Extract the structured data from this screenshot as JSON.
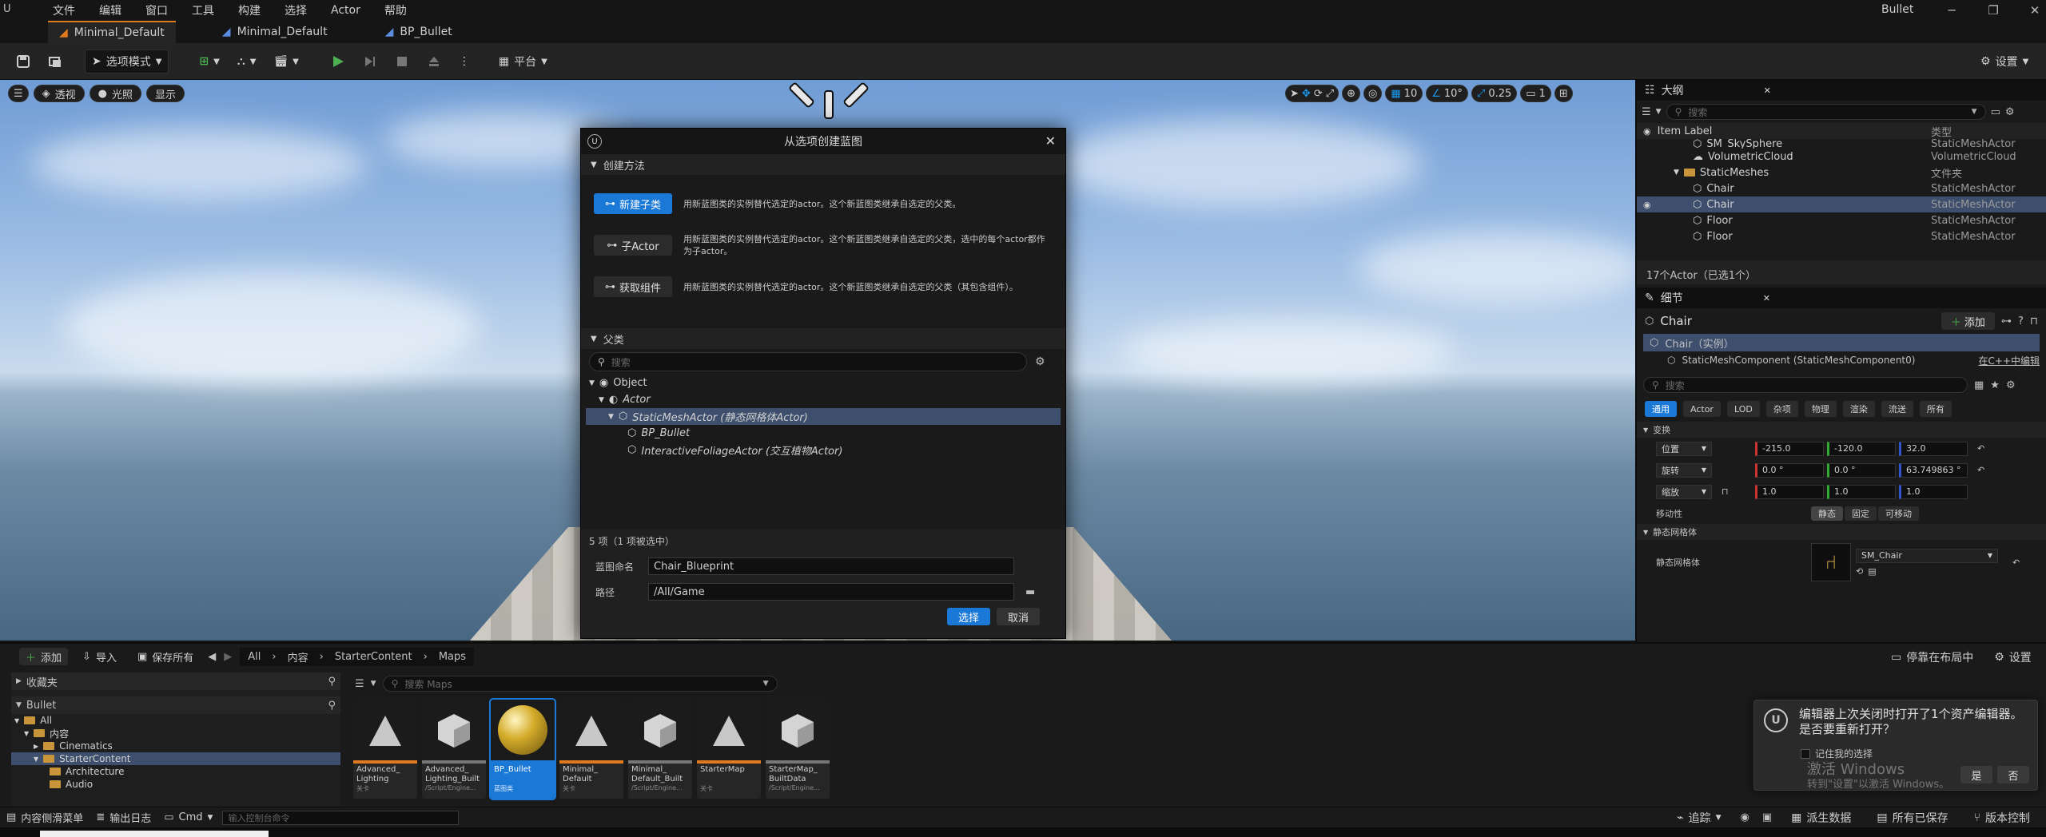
{
  "app": {
    "title": "Bullet",
    "logo": "U"
  },
  "menu": [
    "文件",
    "编辑",
    "窗口",
    "工具",
    "构建",
    "选择",
    "Actor",
    "帮助"
  ],
  "tabs": [
    {
      "label": "Minimal_Default"
    },
    {
      "label": "Minimal_Default"
    },
    {
      "label": "BP_Bullet"
    }
  ],
  "toolbar": {
    "mode": "选项模式",
    "platform": "平台",
    "settings": "设置"
  },
  "viewport": {
    "perspective": "透视",
    "lit": "光照",
    "show": "显示",
    "grid": "10",
    "angle": "10°",
    "scale": "0.25",
    "camera": "1"
  },
  "dialog": {
    "title": "从选项创建蓝图",
    "method_section": "创建方法",
    "methods": [
      {
        "label": "新建子类",
        "desc": "用新蓝图类的实例替代选定的actor。这个新蓝图类继承自选定的父类。"
      },
      {
        "label": "子Actor",
        "desc": "用新蓝图类的实例替代选定的actor。这个新蓝图类继承自选定的父类，选中的每个actor都作为子actor。"
      },
      {
        "label": "获取组件",
        "desc": "用新蓝图类的实例替代选定的actor。这个新蓝图类继承自选定的父类（其包含组件）。"
      }
    ],
    "parent_section": "父类",
    "search_placeholder": "搜索",
    "tree": [
      {
        "label": "Object",
        "indent": 0
      },
      {
        "label": "Actor",
        "indent": 1
      },
      {
        "label": "StaticMeshActor (静态网格体Actor)",
        "indent": 2,
        "selected": true
      },
      {
        "label": "BP_Bullet",
        "indent": 3
      },
      {
        "label": "InteractiveFoliageActor (交互植物Actor)",
        "indent": 3
      }
    ],
    "count": "5 项（1 项被选中）",
    "name_label": "蓝图命名",
    "name_value": "Chair_Blueprint",
    "path_label": "路径",
    "path_value": "/All/Game",
    "select": "选择",
    "cancel": "取消"
  },
  "outliner": {
    "tab": "大纲",
    "search": "搜索",
    "col_label": "Item Label",
    "col_type": "类型",
    "rows": [
      {
        "label": "SM_SkySphere",
        "type": "StaticMeshActor",
        "indent": 2
      },
      {
        "label": "VolumetricCloud",
        "type": "VolumetricCloud",
        "indent": 2
      },
      {
        "label": "StaticMeshes",
        "type": "文件夹",
        "indent": 1,
        "folder": true
      },
      {
        "label": "Chair",
        "type": "StaticMeshActor",
        "indent": 2
      },
      {
        "label": "Chair",
        "type": "StaticMeshActor",
        "indent": 2,
        "selected": true
      },
      {
        "label": "Floor",
        "type": "StaticMeshActor",
        "indent": 2
      },
      {
        "label": "Floor",
        "type": "StaticMeshActor",
        "indent": 2
      }
    ],
    "footer": "17个Actor（已选1个）"
  },
  "details": {
    "tab": "细节",
    "object": "Chair",
    "add": "添加",
    "instance": "Chair（实例）",
    "component": "StaticMeshComponent (StaticMeshComponent0)",
    "cpp": "在C++中编辑",
    "search": "搜索",
    "categories": [
      "通用",
      "Actor",
      "LOD",
      "杂项",
      "物理",
      "渲染",
      "流送",
      "所有"
    ],
    "transform": "变换",
    "location": {
      "label": "位置",
      "x": "-215.0",
      "y": "-120.0",
      "z": "32.0"
    },
    "rotation": {
      "label": "旋转",
      "x": "0.0 °",
      "y": "0.0 °",
      "z": "63.749863 °"
    },
    "scale": {
      "label": "缩放",
      "x": "1.0",
      "y": "1.0",
      "z": "1.0"
    },
    "mobility": {
      "label": "移动性",
      "options": [
        "静态",
        "固定",
        "可移动"
      ]
    },
    "static_mesh_section": "静态网格体",
    "static_mesh_label": "静态网格体",
    "static_mesh_value": "SM_Chair"
  },
  "content_browser": {
    "add": "添加",
    "import": "导入",
    "save_all": "保存所有",
    "breadcrumb": [
      "All",
      "内容",
      "StarterContent",
      "Maps"
    ],
    "dock": "停靠在布局中",
    "settings": "设置",
    "favorites": "收藏夹",
    "project": "Bullet",
    "search": "搜索 Maps",
    "folders": [
      {
        "label": "All",
        "indent": 0
      },
      {
        "label": "内容",
        "indent": 1
      },
      {
        "label": "Cinematics",
        "indent": 2
      },
      {
        "label": "StarterContent",
        "indent": 2,
        "selected": true
      },
      {
        "label": "Architecture",
        "indent": 3
      },
      {
        "label": "Audio",
        "indent": 3
      }
    ],
    "assets": [
      {
        "name": "Advanced_ Lighting",
        "type": "关卡",
        "kind": "level",
        "stripe": "#e07a1f"
      },
      {
        "name": "Advanced_ Lighting_Built",
        "type": "/Script/Engine...",
        "kind": "data",
        "stripe": "#777"
      },
      {
        "name": "BP_Bullet",
        "type": "蓝图类",
        "kind": "sphere",
        "stripe": "#1a78d6",
        "selected": true
      },
      {
        "name": "Minimal_ Default",
        "type": "关卡",
        "kind": "level",
        "stripe": "#e07a1f"
      },
      {
        "name": "Minimal_ Default_Built",
        "type": "/Script/Engine...",
        "kind": "data",
        "stripe": "#777"
      },
      {
        "name": "StarterMap",
        "type": "关卡",
        "kind": "level",
        "stripe": "#e07a1f"
      },
      {
        "name": "StarterMap_ BuiltData",
        "type": "/Script/Engine...",
        "kind": "data",
        "stripe": "#777"
      }
    ]
  },
  "statusbar": {
    "drawer": "内容侧滑菜单",
    "log": "输出日志",
    "cmd": "Cmd",
    "console_placeholder": "输入控制台命令",
    "trace": "追踪",
    "derived": "派生数据",
    "saved": "所有已保存",
    "vcs": "版本控制"
  },
  "toast": {
    "message": "编辑器上次关闭时打开了1个资产编辑器。是否要重新打开？",
    "remember": "记住我的选择",
    "yes": "是",
    "no": "否",
    "watermark1": "激活 Windows",
    "watermark2": "转到\"设置\"以激活 Windows。"
  }
}
